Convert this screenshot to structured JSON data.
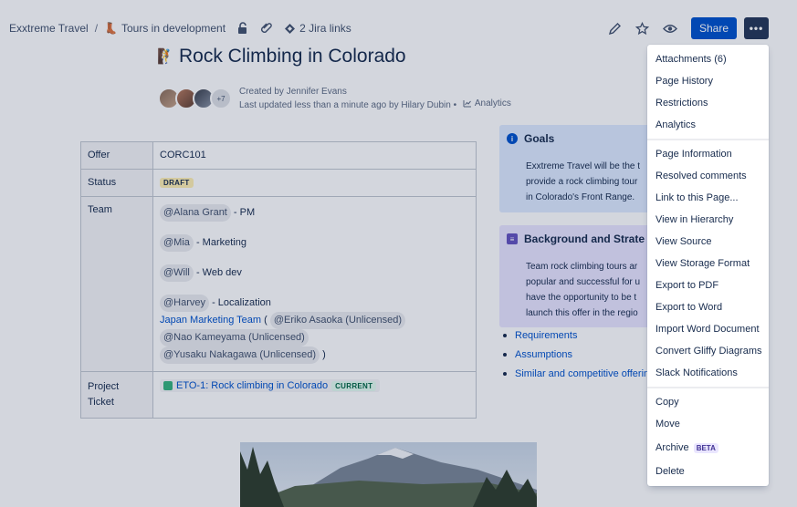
{
  "breadcrumb": {
    "space": "Exxtreme Travel",
    "separator": "/",
    "parent_icon": "boot-emoji",
    "parent": "Tours in development",
    "jira_links": "2 Jira links"
  },
  "header": {
    "share_label": "Share",
    "more_label": "•••"
  },
  "page": {
    "title_icon": "climber-emoji",
    "title": "Rock Climbing in Colorado",
    "avatar_more": "+7",
    "created_by": "Created by Jennifer Evans",
    "updated": "Last updated less than a minute ago by Hilary Dubin",
    "bullet": "•",
    "analytics": "Analytics"
  },
  "table": {
    "offer_key": "Offer",
    "offer_value": "CORC101",
    "status_key": "Status",
    "status_value": "DRAFT",
    "team_key": "Team",
    "team": [
      {
        "mention": "@Alana Grant",
        "role": " - PM"
      },
      {
        "mention": "@Mia",
        "role": " - Marketing"
      },
      {
        "mention": "@Will",
        "role": " - Web dev"
      },
      {
        "mention": "@Harvey",
        "role": " - Localization"
      }
    ],
    "japan_team": "Japan Marketing Team",
    "open_paren": " ( ",
    "mention_eriko": "@Eriko Asaoka (Unlicensed)",
    "mention_nao": "@Nao Kameyama (Unlicensed)",
    "mention_yusaku": "@Yusaku Nakagawa (Unlicensed)",
    "close_paren": " )",
    "project_key": "Project Ticket",
    "project_issue": "ETO-1: Rock climbing in Colorado",
    "project_status": "CURRENT"
  },
  "goals": {
    "heading": "Goals",
    "lines": [
      "Exxtreme Travel will be the t",
      "provide a rock climbing tour",
      "in Colorado's Front Range."
    ]
  },
  "background": {
    "heading": "Background and Strate",
    "lines": [
      "Team rock climbing tours ar",
      "popular and successful for u",
      "have the opportunity to be t",
      "launch this offer in the regio"
    ]
  },
  "links": [
    "Requirements",
    "Assumptions",
    "Similar and competitive offerin"
  ],
  "menu": {
    "group1": [
      "Attachments (6)",
      "Page History",
      "Restrictions",
      "Analytics"
    ],
    "group2": [
      "Page Information",
      "Resolved comments",
      "Link to this Page...",
      "View in Hierarchy",
      "View Source",
      "View Storage Format",
      "Export to PDF",
      "Export to Word",
      "Import Word Document",
      "Convert Gliffy Diagrams",
      "Slack Notifications"
    ],
    "group3": [
      "Copy",
      "Move"
    ],
    "archive": "Archive",
    "beta": "BETA",
    "delete": "Delete"
  }
}
